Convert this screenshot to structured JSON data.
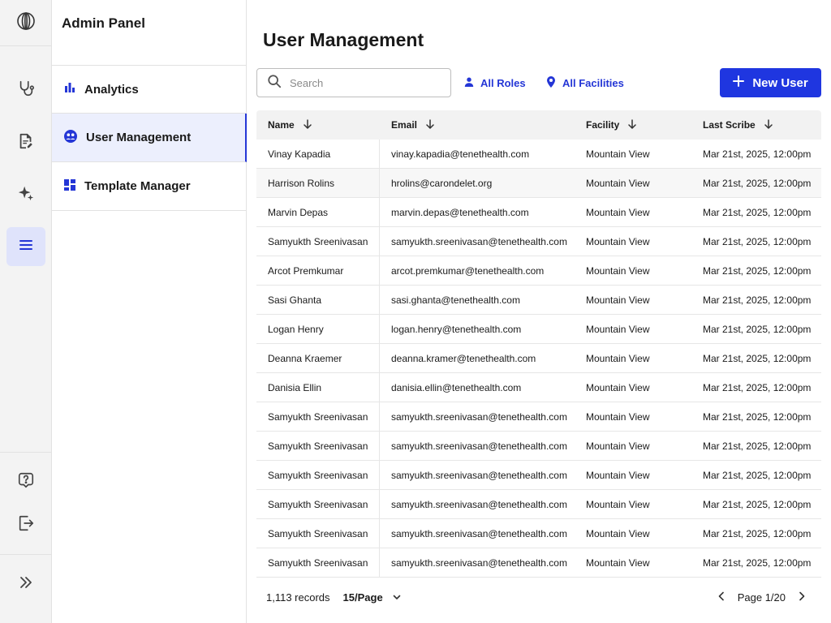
{
  "sidebar": {
    "title": "Admin Panel",
    "items": [
      {
        "label": "Analytics",
        "icon": "bar-chart-icon",
        "active": false
      },
      {
        "label": "User Management",
        "icon": "user-circle-icon",
        "active": true
      },
      {
        "label": "Template Manager",
        "icon": "dashboard-grid-icon",
        "active": false
      }
    ]
  },
  "rail": {
    "icons": [
      "logo-icon",
      "stethoscope-icon",
      "document-edit-icon",
      "sparkle-icon",
      "menu-icon",
      "help-icon",
      "logout-icon",
      "expand-icon"
    ],
    "active": "menu-icon"
  },
  "main": {
    "title": "User Management",
    "search_placeholder": "Search",
    "filters": [
      {
        "label": "All Roles",
        "icon": "person-icon"
      },
      {
        "label": "All Facilities",
        "icon": "location-pin-icon"
      }
    ],
    "new_button": "New User"
  },
  "table": {
    "columns": [
      "Name",
      "Email",
      "Facility",
      "Last Scribe"
    ],
    "rows": [
      [
        "Vinay Kapadia",
        "vinay.kapadia@tenethealth.com",
        "Mountain View",
        "Mar 21st, 2025, 12:00pm"
      ],
      [
        "Harrison Rolins",
        "hrolins@carondelet.org",
        "Mountain View",
        "Mar 21st, 2025, 12:00pm"
      ],
      [
        "Marvin Depas",
        "marvin.depas@tenethealth.com",
        "Mountain View",
        "Mar 21st, 2025, 12:00pm"
      ],
      [
        "Samyukth Sreenivasan",
        "samyukth.sreenivasan@tenethealth.com",
        "Mountain View",
        "Mar 21st, 2025, 12:00pm"
      ],
      [
        "Arcot Premkumar",
        "arcot.premkumar@tenethealth.com",
        "Mountain View",
        "Mar 21st, 2025, 12:00pm"
      ],
      [
        "Sasi Ghanta",
        "sasi.ghanta@tenethealth.com",
        "Mountain View",
        "Mar 21st, 2025, 12:00pm"
      ],
      [
        "Logan Henry",
        "logan.henry@tenethealth.com",
        "Mountain View",
        "Mar 21st, 2025, 12:00pm"
      ],
      [
        "Deanna Kraemer",
        "deanna.kramer@tenethealth.com",
        "Mountain View",
        "Mar 21st, 2025, 12:00pm"
      ],
      [
        "Danisia Ellin",
        "danisia.ellin@tenethealth.com",
        "Mountain View",
        "Mar 21st, 2025, 12:00pm"
      ],
      [
        "Samyukth Sreenivasan",
        "samyukth.sreenivasan@tenethealth.com",
        "Mountain View",
        "Mar 21st, 2025, 12:00pm"
      ],
      [
        "Samyukth Sreenivasan",
        "samyukth.sreenivasan@tenethealth.com",
        "Mountain View",
        "Mar 21st, 2025, 12:00pm"
      ],
      [
        "Samyukth Sreenivasan",
        "samyukth.sreenivasan@tenethealth.com",
        "Mountain View",
        "Mar 21st, 2025, 12:00pm"
      ],
      [
        "Samyukth Sreenivasan",
        "samyukth.sreenivasan@tenethealth.com",
        "Mountain View",
        "Mar 21st, 2025, 12:00pm"
      ],
      [
        "Samyukth Sreenivasan",
        "samyukth.sreenivasan@tenethealth.com",
        "Mountain View",
        "Mar 21st, 2025, 12:00pm"
      ],
      [
        "Samyukth Sreenivasan",
        "samyukth.sreenivasan@tenethealth.com",
        "Mountain View",
        "Mar 21st, 2025, 12:00pm"
      ]
    ],
    "highlighted_row": 1
  },
  "footer": {
    "records": "1,113 records",
    "per_page": "15/Page",
    "page": "Page 1/20"
  },
  "colors": {
    "accent": "#1f36e0",
    "link": "#2436d6",
    "active_bg": "#eceffd",
    "rail_active_bg": "#dfe3fb"
  }
}
